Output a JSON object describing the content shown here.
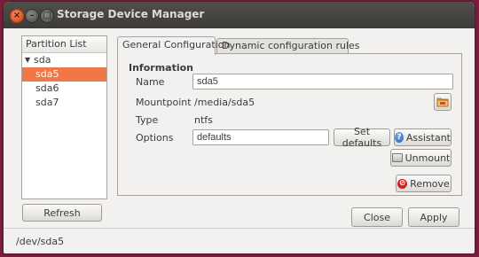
{
  "window": {
    "title": "Storage Device Manager",
    "close_glyph": "×",
    "min_glyph": "–",
    "max_glyph": "□"
  },
  "partition_list": {
    "header": "Partition List",
    "disk": "sda",
    "items": [
      {
        "label": "sda5",
        "selected": true
      },
      {
        "label": "sda6",
        "selected": false
      },
      {
        "label": "sda7",
        "selected": false
      }
    ]
  },
  "refresh_label": "Refresh",
  "tabs": [
    {
      "label": "General Configuration",
      "active": true
    },
    {
      "label": "Dynamic configuration rules",
      "active": false
    }
  ],
  "general": {
    "section_title": "Information",
    "name_label": "Name",
    "name_value": "sda5",
    "mountpoint_label": "Mountpoint",
    "mountpoint_value": "/media/sda5",
    "type_label": "Type",
    "type_value": "ntfs",
    "options_label": "Options",
    "options_value": "defaults",
    "set_defaults_label": "Set defaults",
    "assistant_label": "Assistant",
    "unmount_label": "Unmount",
    "remove_label": "Remove"
  },
  "close_label": "Close",
  "apply_label": "Apply",
  "status_text": "/dev/sda5",
  "icons": {
    "assistant": "help-icon",
    "unmount": "eject-icon",
    "remove": "remove-icon",
    "folder": "folder-icon"
  },
  "colors": {
    "selection": "#f07746",
    "titlebar": "#3c3b37",
    "close_button": "#e0531c"
  }
}
